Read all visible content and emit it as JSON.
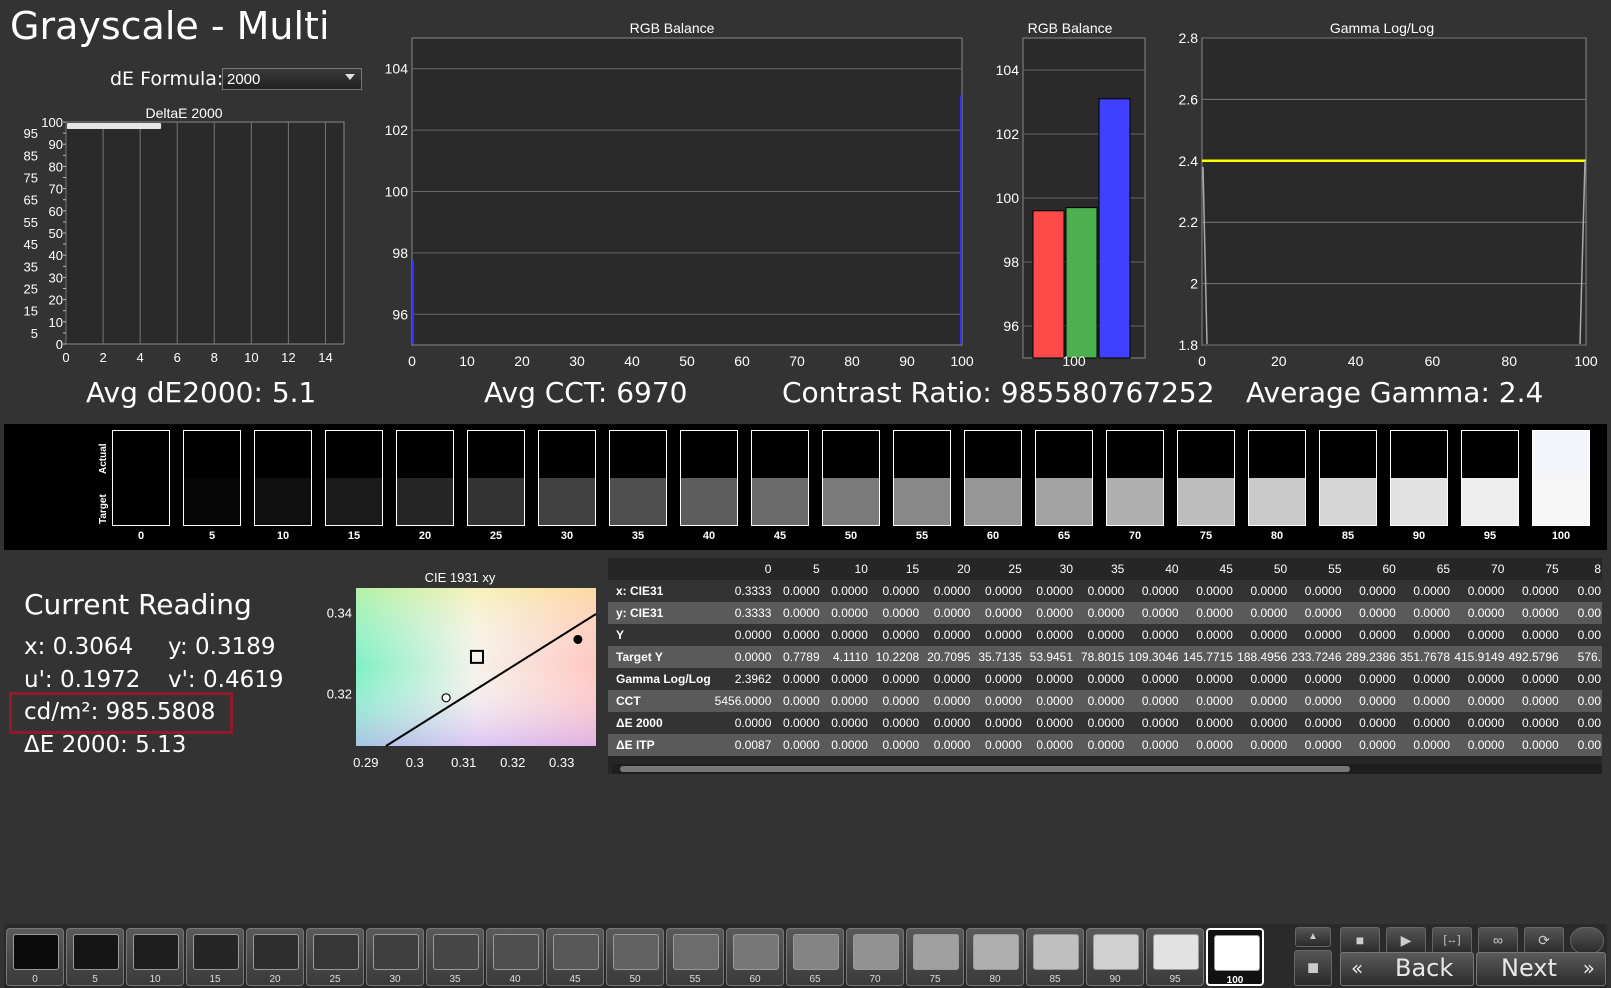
{
  "title": "Grayscale - Multi",
  "de_formula": {
    "label": "dE Formula:",
    "value": "2000"
  },
  "charts": {
    "deltae": {
      "title": "DeltaE 2000",
      "x_ticks": [
        "0",
        "2",
        "4",
        "6",
        "8",
        "10",
        "12",
        "14"
      ],
      "y_ticks": [
        "0",
        "5",
        "10",
        "15",
        "20",
        "25",
        "30",
        "35",
        "40",
        "45",
        "50",
        "55",
        "60",
        "65",
        "70",
        "75",
        "80",
        "85",
        "90",
        "95",
        "100"
      ]
    },
    "rgb_balance_line": {
      "title": "RGB Balance",
      "x_ticks": [
        "0",
        "10",
        "20",
        "30",
        "40",
        "50",
        "60",
        "70",
        "80",
        "90",
        "100"
      ],
      "y_ticks": [
        "96",
        "98",
        "100",
        "102",
        "104"
      ]
    },
    "rgb_balance_bar": {
      "title": "RGB Balance",
      "x_ticks": [
        "100"
      ],
      "y_ticks": [
        "96",
        "98",
        "100",
        "102",
        "104"
      ]
    },
    "gamma": {
      "title": "Gamma Log/Log",
      "x_ticks": [
        "0",
        "20",
        "40",
        "60",
        "80",
        "100"
      ],
      "y_ticks": [
        "1.8",
        "2",
        "2.2",
        "2.4",
        "2.6",
        "2.8"
      ]
    },
    "cie": {
      "title": "CIE 1931 xy",
      "x_ticks": [
        "0.29",
        "0.3",
        "0.31",
        "0.32",
        "0.33"
      ],
      "y_ticks": [
        "0.32",
        "0.34"
      ]
    }
  },
  "chart_data": [
    {
      "type": "bar",
      "title": "DeltaE 2000",
      "xlim": [
        0,
        15
      ],
      "ylim": [
        0,
        100
      ],
      "categories": [
        "100"
      ],
      "values": [
        5.13
      ]
    },
    {
      "type": "line",
      "title": "RGB Balance",
      "xlim": [
        0,
        100
      ],
      "ylim": [
        95,
        105
      ]
    },
    {
      "type": "bar",
      "title": "RGB Balance",
      "ylim": [
        95,
        105
      ],
      "categories": [
        "100"
      ],
      "series": [
        {
          "values": [
            99.6
          ],
          "color": "#ff4a4a"
        },
        {
          "values": [
            99.7
          ],
          "color": "#4caf50"
        },
        {
          "values": [
            103.1
          ],
          "color": "#4040ff"
        }
      ]
    },
    {
      "type": "line",
      "title": "Gamma Log/Log",
      "xlim": [
        0,
        100
      ],
      "ylim": [
        1.8,
        2.8
      ],
      "target_gamma": 2.4,
      "target_color": "#ffff00"
    },
    {
      "type": "scatter",
      "title": "CIE 1931 xy",
      "xlim": [
        0.288,
        0.337
      ],
      "ylim": [
        0.307,
        0.346
      ],
      "target": [
        0.3127,
        0.329
      ],
      "measured": [
        0.3064,
        0.3189
      ],
      "reference": [
        0.3333,
        0.3333
      ]
    }
  ],
  "summary": {
    "avg_de": "Avg dE2000: 5.1",
    "avg_cct": "Avg CCT: 6970",
    "contrast": "Contrast Ratio: 985580767252",
    "avg_gamma": "Average Gamma: 2.4"
  },
  "swatches": {
    "actual_label": "Actual",
    "target_label": "Target",
    "items": [
      {
        "label": "0",
        "actual": "#000000",
        "target": "#000000"
      },
      {
        "label": "5",
        "actual": "#000000",
        "target": "#060606"
      },
      {
        "label": "10",
        "actual": "#000000",
        "target": "#101010"
      },
      {
        "label": "15",
        "actual": "#000000",
        "target": "#1a1a1a"
      },
      {
        "label": "20",
        "actual": "#000000",
        "target": "#262626"
      },
      {
        "label": "25",
        "actual": "#000000",
        "target": "#333333"
      },
      {
        "label": "30",
        "actual": "#000000",
        "target": "#414141"
      },
      {
        "label": "35",
        "actual": "#000000",
        "target": "#4f4f4f"
      },
      {
        "label": "40",
        "actual": "#000000",
        "target": "#5d5d5d"
      },
      {
        "label": "45",
        "actual": "#000000",
        "target": "#6b6b6b"
      },
      {
        "label": "50",
        "actual": "#000000",
        "target": "#7a7a7a"
      },
      {
        "label": "55",
        "actual": "#000000",
        "target": "#888888"
      },
      {
        "label": "60",
        "actual": "#000000",
        "target": "#969696"
      },
      {
        "label": "65",
        "actual": "#000000",
        "target": "#a3a3a3"
      },
      {
        "label": "70",
        "actual": "#000000",
        "target": "#b0b0b0"
      },
      {
        "label": "75",
        "actual": "#000000",
        "target": "#bdbdbd"
      },
      {
        "label": "80",
        "actual": "#000000",
        "target": "#c9c9c9"
      },
      {
        "label": "85",
        "actual": "#000000",
        "target": "#d6d6d6"
      },
      {
        "label": "90",
        "actual": "#000000",
        "target": "#e2e2e2"
      },
      {
        "label": "95",
        "actual": "#000000",
        "target": "#eeeeee"
      },
      {
        "label": "100",
        "actual": "#f4f4fb",
        "target": "#f7f7f7"
      }
    ]
  },
  "current_reading": {
    "title": "Current Reading",
    "x": "x: 0.3064",
    "y": "y: 0.3189",
    "u": "u': 0.1972",
    "v": "v': 0.4619",
    "cd": "cd/m²: 985.5808",
    "de": "ΔE 2000: 5.13"
  },
  "table": {
    "columns": [
      "0",
      "5",
      "10",
      "15",
      "20",
      "25",
      "30",
      "35",
      "40",
      "45",
      "50",
      "55",
      "60",
      "65",
      "70",
      "75",
      "8"
    ],
    "rows": [
      {
        "label": "x: CIE31",
        "values": [
          "0.3333",
          "0.0000",
          "0.0000",
          "0.0000",
          "0.0000",
          "0.0000",
          "0.0000",
          "0.0000",
          "0.0000",
          "0.0000",
          "0.0000",
          "0.0000",
          "0.0000",
          "0.0000",
          "0.0000",
          "0.0000",
          "0.00"
        ]
      },
      {
        "label": "y: CIE31",
        "values": [
          "0.3333",
          "0.0000",
          "0.0000",
          "0.0000",
          "0.0000",
          "0.0000",
          "0.0000",
          "0.0000",
          "0.0000",
          "0.0000",
          "0.0000",
          "0.0000",
          "0.0000",
          "0.0000",
          "0.0000",
          "0.0000",
          "0.00"
        ]
      },
      {
        "label": "Y",
        "values": [
          "0.0000",
          "0.0000",
          "0.0000",
          "0.0000",
          "0.0000",
          "0.0000",
          "0.0000",
          "0.0000",
          "0.0000",
          "0.0000",
          "0.0000",
          "0.0000",
          "0.0000",
          "0.0000",
          "0.0000",
          "0.0000",
          "0.00"
        ]
      },
      {
        "label": "Target Y",
        "values": [
          "0.0000",
          "0.7789",
          "4.1110",
          "10.2208",
          "20.7095",
          "35.7135",
          "53.9451",
          "78.8015",
          "109.3046",
          "145.7715",
          "188.4956",
          "233.7246",
          "289.2386",
          "351.7678",
          "415.9149",
          "492.5796",
          "576."
        ]
      },
      {
        "label": "Gamma Log/Log",
        "values": [
          "2.3962",
          "0.0000",
          "0.0000",
          "0.0000",
          "0.0000",
          "0.0000",
          "0.0000",
          "0.0000",
          "0.0000",
          "0.0000",
          "0.0000",
          "0.0000",
          "0.0000",
          "0.0000",
          "0.0000",
          "0.0000",
          "0.00"
        ]
      },
      {
        "label": "CCT",
        "values": [
          "5456.0000",
          "0.0000",
          "0.0000",
          "0.0000",
          "0.0000",
          "0.0000",
          "0.0000",
          "0.0000",
          "0.0000",
          "0.0000",
          "0.0000",
          "0.0000",
          "0.0000",
          "0.0000",
          "0.0000",
          "0.0000",
          "0.00"
        ]
      },
      {
        "label": "ΔE 2000",
        "values": [
          "0.0000",
          "0.0000",
          "0.0000",
          "0.0000",
          "0.0000",
          "0.0000",
          "0.0000",
          "0.0000",
          "0.0000",
          "0.0000",
          "0.0000",
          "0.0000",
          "0.0000",
          "0.0000",
          "0.0000",
          "0.0000",
          "0.00"
        ]
      },
      {
        "label": "ΔE ITP",
        "values": [
          "0.0087",
          "0.0000",
          "0.0000",
          "0.0000",
          "0.0000",
          "0.0000",
          "0.0000",
          "0.0000",
          "0.0000",
          "0.0000",
          "0.0000",
          "0.0000",
          "0.0000",
          "0.0000",
          "0.0000",
          "0.0000",
          "0.00"
        ]
      }
    ]
  },
  "patches": {
    "active": "100",
    "items": [
      {
        "label": "0",
        "color": "#0b0b0b"
      },
      {
        "label": "5",
        "color": "#151515"
      },
      {
        "label": "10",
        "color": "#1e1e1e"
      },
      {
        "label": "15",
        "color": "#262626"
      },
      {
        "label": "20",
        "color": "#2e2e2e"
      },
      {
        "label": "25",
        "color": "#363636"
      },
      {
        "label": "30",
        "color": "#3f3f3f"
      },
      {
        "label": "35",
        "color": "#474747"
      },
      {
        "label": "40",
        "color": "#4f4f4f"
      },
      {
        "label": "45",
        "color": "#585858"
      },
      {
        "label": "50",
        "color": "#626262"
      },
      {
        "label": "55",
        "color": "#6c6c6c"
      },
      {
        "label": "60",
        "color": "#777777"
      },
      {
        "label": "65",
        "color": "#848484"
      },
      {
        "label": "70",
        "color": "#929292"
      },
      {
        "label": "75",
        "color": "#a0a0a0"
      },
      {
        "label": "80",
        "color": "#afafaf"
      },
      {
        "label": "85",
        "color": "#bfbfbf"
      },
      {
        "label": "90",
        "color": "#d0d0d0"
      },
      {
        "label": "95",
        "color": "#e2e2e2"
      },
      {
        "label": "100",
        "color": "#ffffff"
      }
    ]
  },
  "nav": {
    "back": "Back",
    "next": "Next",
    "back_glyph": "«",
    "next_glyph": "»"
  },
  "controls": {
    "stop": "■",
    "play": "▶",
    "fit": "[↔]",
    "loop": "∞",
    "refresh": "⟳",
    "up": "▲"
  }
}
